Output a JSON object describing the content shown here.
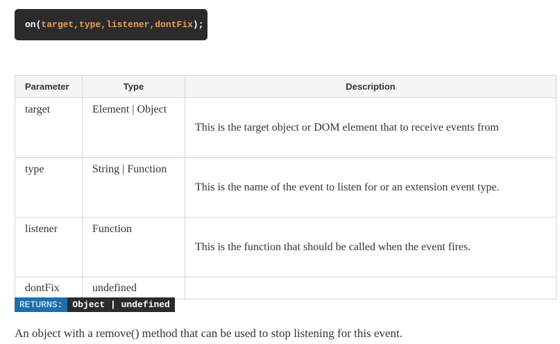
{
  "signature": {
    "name": "on",
    "open": "(",
    "params": [
      "target",
      "type",
      "listener",
      "dontFix"
    ],
    "sep": ",",
    "close": ");"
  },
  "table": {
    "headers": {
      "parameter": "Parameter",
      "type": "Type",
      "description": "Description"
    },
    "rows": [
      {
        "parameter": "target",
        "type": "Element | Object",
        "description": "This is the target object or DOM element that to receive events from"
      },
      {
        "parameter": "type",
        "type": "String | Function",
        "description": "This is the name of the event to listen for or an extension event type."
      },
      {
        "parameter": "listener",
        "type": "Function",
        "description": "This is the function that should be called when the event fires."
      },
      {
        "parameter": "dontFix",
        "type": "undefined",
        "description": ""
      }
    ]
  },
  "returns": {
    "label": "RETURNS:",
    "value": "Object | undefined"
  },
  "summary": "An object with a remove() method that can be used to stop listening for this event.",
  "colors": {
    "code_bg": "#2b2b2b",
    "param_highlight": "#f0a04b",
    "returns_label_bg": "#1b6fae"
  }
}
